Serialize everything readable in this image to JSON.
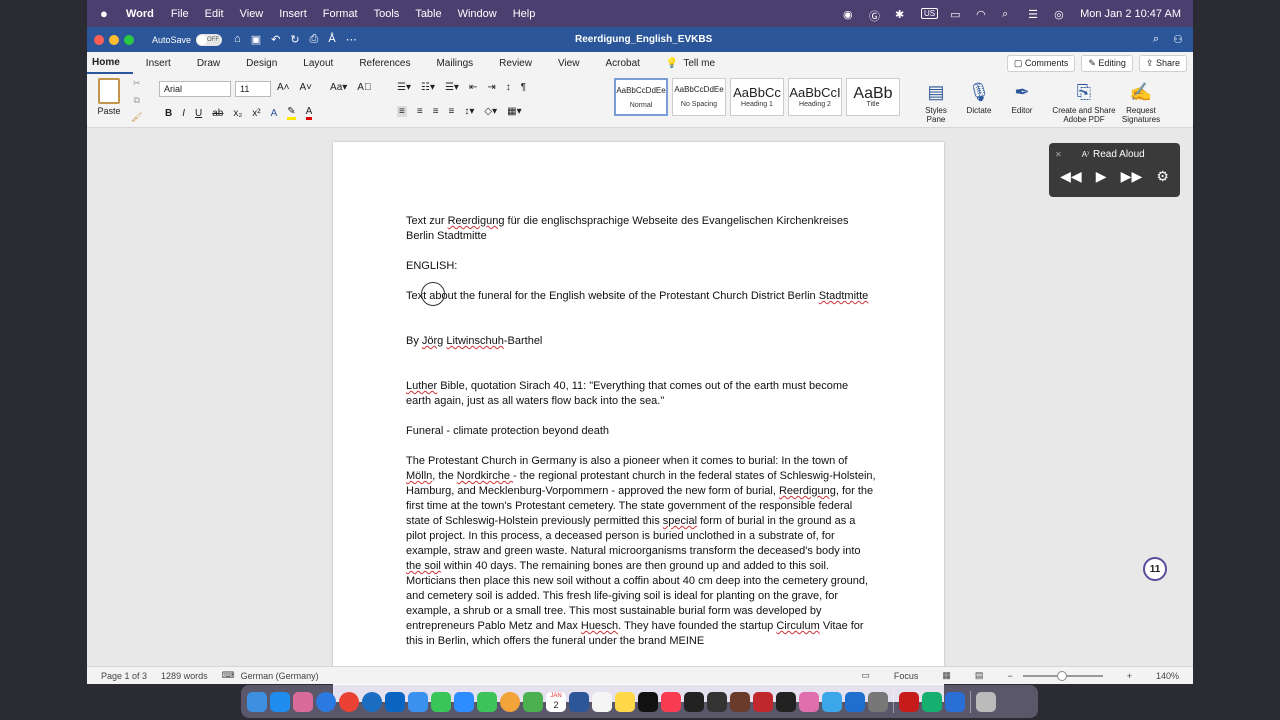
{
  "menubar": {
    "app": "Word",
    "items": [
      "File",
      "Edit",
      "View",
      "Insert",
      "Format",
      "Tools",
      "Table",
      "Window",
      "Help"
    ],
    "input_badge": "US",
    "datetime": "Mon Jan 2  10:47 AM"
  },
  "titlebar": {
    "autosave_label": "AutoSave",
    "autosave_state": "OFF",
    "doc_title": "Reerdigung_English_EVKBS"
  },
  "ribbon_tabs": {
    "tabs": [
      "Home",
      "Insert",
      "Draw",
      "Design",
      "Layout",
      "References",
      "Mailings",
      "Review",
      "View",
      "Acrobat"
    ],
    "tell_me": "Tell me",
    "comments": "Comments",
    "editing": "Editing",
    "share": "Share"
  },
  "ribbon": {
    "paste": "Paste",
    "font": "Arial",
    "size": "11",
    "styles": [
      {
        "preview": "AaBbCcDdEe",
        "name": "Normal"
      },
      {
        "preview": "AaBbCcDdEe",
        "name": "No Spacing"
      },
      {
        "preview": "AaBbCc",
        "name": "Heading 1"
      },
      {
        "preview": "AaBbCcI",
        "name": "Heading 2"
      },
      {
        "preview": "AaBb",
        "name": "Title"
      }
    ],
    "styles_pane": "Styles Pane",
    "dictate": "Dictate",
    "editor": "Editor",
    "create_share": "Create and Share Adobe PDF",
    "request_sig": "Request Signatures"
  },
  "document": {
    "p1_a": "Text zur ",
    "p1_b": "Reerdigung",
    "p1_c": " für die englischsprachige Webseite des Evangelischen Kirchenkreises Berlin Stadtmitte",
    "p2": "ENGLISH:",
    "p3_a": "Text about the funeral for the English website of the Protestant Church District Berlin ",
    "p3_b": "Stadtmitte",
    "p4_a": "By ",
    "p4_b": "Jörg",
    "p4_c": " ",
    "p4_d": "Litwinschuh",
    "p4_e": "-Barthel",
    "p5_a": "Luther",
    "p5_b": " Bible, quotation Sirach 40, 11: \"Everything that comes out of the earth must become earth again, just as all waters flow back into the sea.\"",
    "p6": "Funeral - climate protection beyond death",
    "p7_a": "The Protestant Church in Germany is also a pioneer when it comes to burial: In the town of ",
    "p7_b": "Mölln",
    "p7_c": ", the ",
    "p7_d": "Nordkirche ",
    "p7_e": "- the regional protestant church in the federal states of Schleswig-Holstein, Hamburg, and Mecklenburg-Vorpommern - approved the new form of burial, ",
    "p7_f": "Reerdigung",
    "p7_g": ", for the first time at the town's Protestant cemetery. The state government of the responsible federal state of Schleswig-Holstein previously permitted this ",
    "p7_h": "special",
    "p7_i": " form of burial in the ground as a pilot project. In this process, a deceased person is buried unclothed in a substrate of, for example, straw and green waste. Natural microorganisms transform the deceased's body into ",
    "p7_j": "the soil",
    "p7_k": " within 40 days. The remaining bones are then ground up and added to this soil. Morticians then place this new soil without a coffin about 40 cm deep into the cemetery ground, and cemetery soil is added. This fresh life-giving soil is ideal for planting on the grave, for example, a shrub or a small tree. This most sustainable burial form was developed by entrepreneurs Pablo Metz and Max ",
    "p7_l": "Huesch",
    "p7_m": ". They have founded the startup ",
    "p7_n": "Circulum",
    "p7_o": " Vitae for this in Berlin, which offers the funeral under the brand MEINE"
  },
  "read_aloud": {
    "title": "Read Aloud"
  },
  "badge_count": "11",
  "statusbar": {
    "page": "Page 1 of 3",
    "words": "1289 words",
    "language": "German (Germany)",
    "focus": "Focus",
    "zoom": "140%"
  },
  "dock": {
    "calendar_month": "JAN",
    "calendar_day": "2"
  }
}
